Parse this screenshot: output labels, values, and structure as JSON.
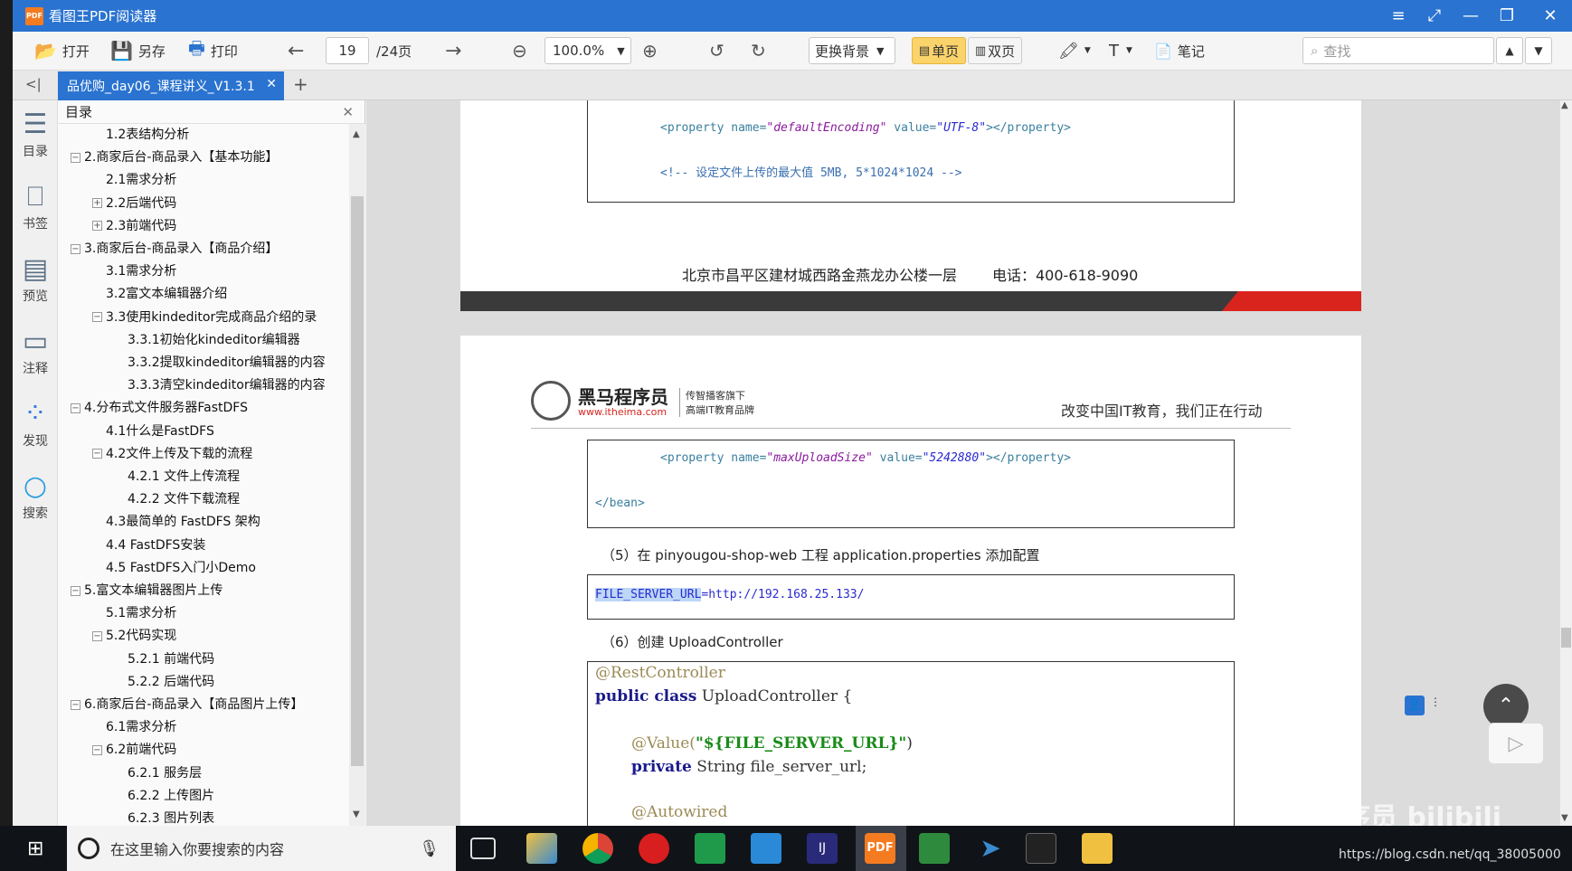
{
  "window": {
    "title": "看图王PDF阅读器",
    "logo_text": "PDF"
  },
  "window_controls": [
    "≡",
    "⤢",
    "—",
    "❐",
    "✕"
  ],
  "toolbar": {
    "open": "打开",
    "save_as": "另存",
    "print": "打印",
    "page_current": "19",
    "page_total": "/24页",
    "zoom": "100.0%",
    "background": "更换背景",
    "single": "单页",
    "double": "双页",
    "notes": "笔记",
    "search_placeholder": "查找"
  },
  "tab": {
    "label": "品优购_day06_课程讲义_V1.3.1",
    "add": "+",
    "collapse": "<|"
  },
  "side": [
    "目录",
    "书签",
    "预览",
    "注释",
    "发现",
    "搜索"
  ],
  "toc": {
    "title": "目录",
    "items": [
      {
        "level": 2,
        "label": "1.2表结构分析",
        "toggle": ""
      },
      {
        "level": 1,
        "label": "2.商家后台-商品录入【基本功能】",
        "toggle": "−"
      },
      {
        "level": 2,
        "label": "2.1需求分析",
        "toggle": ""
      },
      {
        "level": 2,
        "label": "2.2后端代码",
        "toggle": "+"
      },
      {
        "level": 2,
        "label": "2.3前端代码",
        "toggle": "+"
      },
      {
        "level": 1,
        "label": "3.商家后台-商品录入【商品介绍】",
        "toggle": "−"
      },
      {
        "level": 2,
        "label": "3.1需求分析",
        "toggle": ""
      },
      {
        "level": 2,
        "label": "3.2富文本编辑器介绍",
        "toggle": ""
      },
      {
        "level": 2,
        "label": "3.3使用kindeditor完成商品介绍的录",
        "toggle": "−"
      },
      {
        "level": 3,
        "label": "3.3.1初始化kindeditor编辑器",
        "toggle": ""
      },
      {
        "level": 3,
        "label": "3.3.2提取kindeditor编辑器的内容",
        "toggle": ""
      },
      {
        "level": 3,
        "label": "3.3.3清空kindeditor编辑器的内容",
        "toggle": ""
      },
      {
        "level": 1,
        "label": "4.分布式文件服务器FastDFS",
        "toggle": "−"
      },
      {
        "level": 2,
        "label": "4.1什么是FastDFS",
        "toggle": ""
      },
      {
        "level": 2,
        "label": "4.2文件上传及下载的流程",
        "toggle": "−"
      },
      {
        "level": 3,
        "label": "4.2.1 文件上传流程",
        "toggle": ""
      },
      {
        "level": 3,
        "label": "4.2.2 文件下载流程",
        "toggle": ""
      },
      {
        "level": 2,
        "label": "4.3最简单的 FastDFS 架构",
        "toggle": ""
      },
      {
        "level": 2,
        "label": "4.4 FastDFS安装",
        "toggle": ""
      },
      {
        "level": 2,
        "label": "4.5 FastDFS入门小Demo",
        "toggle": ""
      },
      {
        "level": 1,
        "label": "5.富文本编辑器图片上传",
        "toggle": "−"
      },
      {
        "level": 2,
        "label": "5.1需求分析",
        "toggle": ""
      },
      {
        "level": 2,
        "label": "5.2代码实现",
        "toggle": "−"
      },
      {
        "level": 3,
        "label": "5.2.1 前端代码",
        "toggle": ""
      },
      {
        "level": 3,
        "label": "5.2.2 后端代码",
        "toggle": ""
      },
      {
        "level": 1,
        "label": "6.商家后台-商品录入【商品图片上传】",
        "toggle": "−"
      },
      {
        "level": 2,
        "label": "6.1需求分析",
        "toggle": ""
      },
      {
        "level": 2,
        "label": "6.2前端代码",
        "toggle": "−"
      },
      {
        "level": 3,
        "label": "6.2.1 服务层",
        "toggle": ""
      },
      {
        "level": 3,
        "label": "6.2.2 上传图片",
        "toggle": ""
      },
      {
        "level": 3,
        "label": "6.2.3 图片列表",
        "toggle": ""
      }
    ]
  },
  "page1": {
    "code_line1_tag": "<property name=",
    "code_line1_name": "\"defaultEncoding\"",
    "code_line1_attr": " value=",
    "code_line1_val": "\"UTF-8\"",
    "code_line1_end": "></property>",
    "code_line2": "<!-- 设定文件上传的最大值 5MB, 5*1024*1024 -->",
    "footer_address": "北京市昌平区建材城西路金燕龙办公楼一层",
    "footer_phone": "电话：400-618-9090"
  },
  "page2": {
    "brand_name": "黑马程序员",
    "brand_url": "www.itheima.com",
    "brand_slogan1": "传智播客旗下",
    "brand_slogan2": "高端IT教育品牌",
    "header_right": "改变中国IT教育，我们正在行动",
    "code1_tag": "<property name=",
    "code1_name": "\"maxUploadSize\"",
    "code1_attr": " value=",
    "code1_val": "\"5242880\"",
    "code1_end": "></property>",
    "code1_close": "</bean>",
    "step5": "（5）在 pinyougou-shop-web 工程 application.properties 添加配置",
    "prop_key": "FILE_SERVER_URL",
    "prop_val": "=http://192.168.25.133/",
    "step6": "（6）创建 UploadController",
    "java_annot": "@RestController",
    "java_kw": "public class",
    "java_class": " UploadController {",
    "java_value_annot": "@Value(",
    "java_value_str": "\"${FILE_SERVER_URL}\"",
    "java_value_close": ")",
    "java_private": "private",
    "java_field": "  String file_server_url;",
    "java_autowired": "@Autowired"
  },
  "taskbar": {
    "search_placeholder": "在这里输入你要搜索的内容",
    "url_watermark": "https://blog.csdn.net/qq_38005000",
    "watermark": "黑马程序员 bilibili"
  },
  "colors": {
    "titlebar": "#2a73d0",
    "accent_red": "#d9241d",
    "dark_band": "#3a3a3a",
    "code_tag": "#3a7f9e",
    "code_name": "#8b1a9e",
    "code_val": "#2a2ad0",
    "comment": "#3a6fb0"
  }
}
